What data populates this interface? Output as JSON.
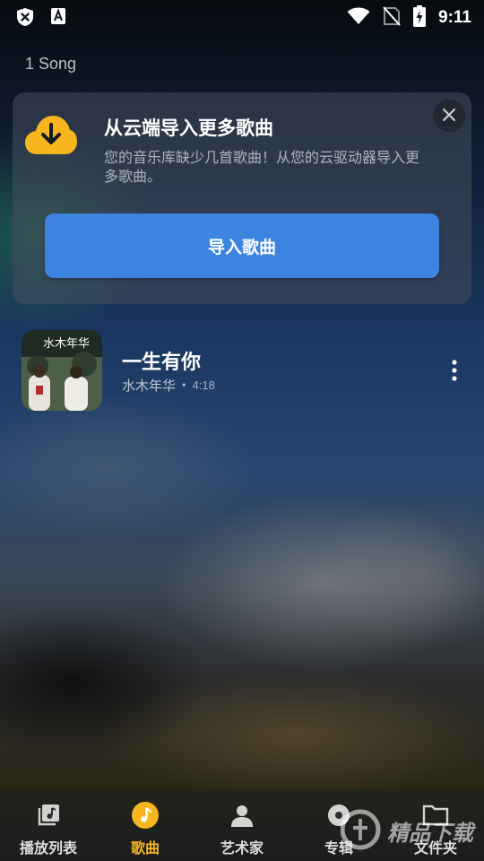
{
  "status_bar": {
    "time": "9:11",
    "left_icons": [
      "close-box-icon",
      "font-a-icon"
    ],
    "right_icons": [
      "wifi-icon",
      "no-sim-icon",
      "battery-charging-icon"
    ]
  },
  "library": {
    "song_count": "1 Song"
  },
  "import_card": {
    "title": "从云端导入更多歌曲",
    "description": "您的音乐库缺少几首歌曲！从您的云驱动器导入更多歌曲。",
    "button_label": "导入歌曲",
    "icon": "cloud-download-icon",
    "accent": "#3d83e0",
    "icon_color": "#f7b51f"
  },
  "songs": [
    {
      "title": "一生有你",
      "artist": "水木年华",
      "separator": "•",
      "duration": "4:18",
      "album_text": "水木年华"
    }
  ],
  "bottom_nav": {
    "items": [
      {
        "label": "播放列表",
        "icon": "playlist-icon",
        "active": false
      },
      {
        "label": "歌曲",
        "icon": "music-note-icon",
        "active": true
      },
      {
        "label": "艺术家",
        "icon": "person-icon",
        "active": false
      },
      {
        "label": "专辑",
        "icon": "album-icon",
        "active": false
      },
      {
        "label": "文件夹",
        "icon": "folder-icon",
        "active": false
      }
    ],
    "active_color": "#f7b51f"
  },
  "watermark": {
    "text": "精品下载"
  }
}
